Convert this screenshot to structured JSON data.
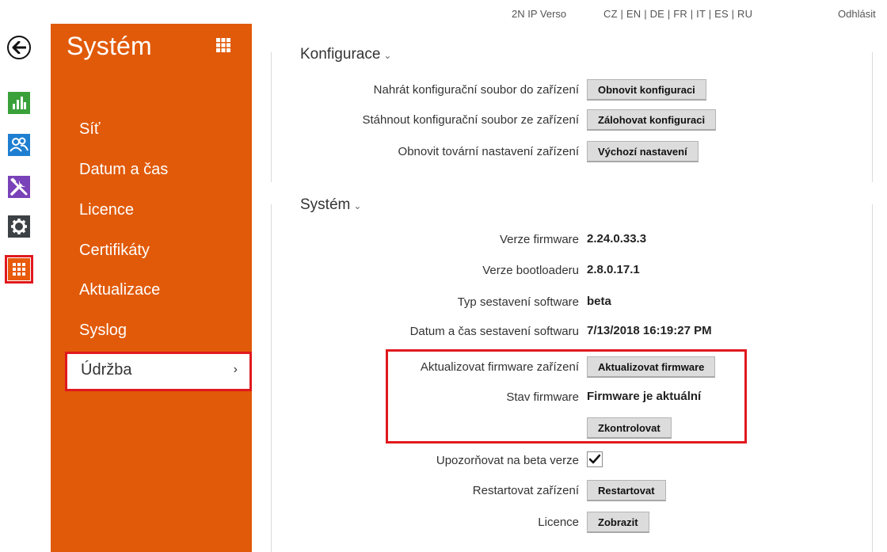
{
  "topbar": {
    "device": "2N IP Verso",
    "languages": "CZ | EN | DE | FR | IT | ES | RU",
    "logout": "Odhlásit"
  },
  "rail": {
    "items": [
      {
        "icon": "back-arrow-icon"
      },
      {
        "icon": "bar-chart-icon",
        "color": "#3aa13a"
      },
      {
        "icon": "users-icon",
        "color": "#1e7fd1"
      },
      {
        "icon": "tools-icon",
        "color": "#7a42b8"
      },
      {
        "icon": "gear-icon",
        "color": "#3b4145"
      },
      {
        "icon": "grid-icon",
        "color": "#e85a0c"
      }
    ]
  },
  "sidebar": {
    "title": "Systém",
    "accent": "#e15a09",
    "items": [
      {
        "label": "Síť"
      },
      {
        "label": "Datum a čas"
      },
      {
        "label": "Licence"
      },
      {
        "label": "Certifikáty"
      },
      {
        "label": "Aktualizace"
      },
      {
        "label": "Syslog"
      },
      {
        "label": "Údržba",
        "active": true
      }
    ]
  },
  "config": {
    "title": "Konfigurace",
    "rows": [
      {
        "label": "Nahrát konfigurační soubor do zařízení",
        "button": "Obnovit konfiguraci"
      },
      {
        "label": "Stáhnout konfigurační soubor ze zařízení",
        "button": "Zálohovat konfiguraci"
      },
      {
        "label": "Obnovit tovární nastavení zařízení",
        "button": "Výchozí nastavení"
      }
    ]
  },
  "system": {
    "title": "Systém",
    "firmware_version_label": "Verze firmware",
    "firmware_version": "2.24.0.33.3",
    "bootloader_label": "Verze bootloaderu",
    "bootloader": "2.8.0.17.1",
    "build_type_label": "Typ sestavení software",
    "build_type": "beta",
    "build_date_label": "Datum a čas sestavení softwaru",
    "build_date": "7/13/2018 16:19:27 PM",
    "update_label": "Aktualizovat firmware zařízení",
    "update_button": "Aktualizovat firmware",
    "status_label": "Stav firmware",
    "status": "Firmware je aktuální",
    "check_button": "Zkontrolovat",
    "beta_label": "Upozorňovat na beta verze",
    "beta_checked": true,
    "restart_label": "Restartovat zařízení",
    "restart_button": "Restartovat",
    "license_label": "Licence",
    "license_button": "Zobrazit"
  }
}
